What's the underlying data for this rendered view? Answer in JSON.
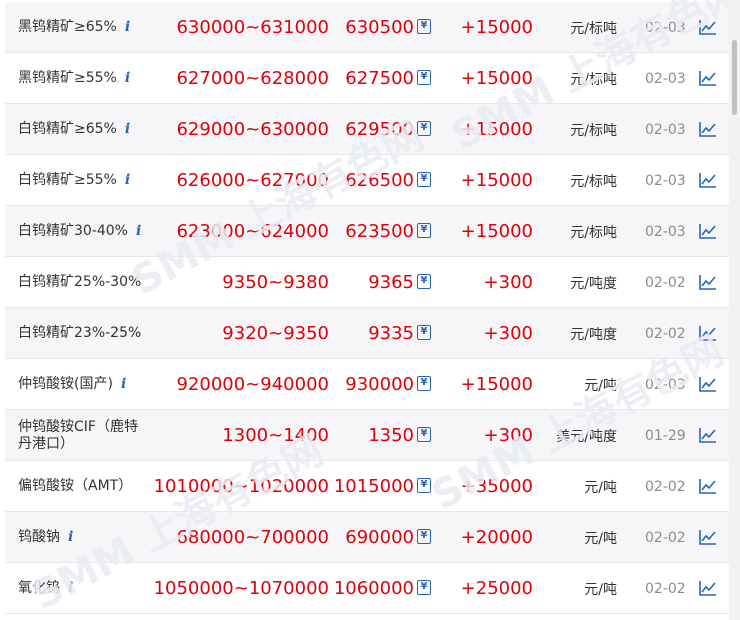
{
  "colors": {
    "price_red": "#e0000b",
    "info_blue": "#2a64b8",
    "text_dark": "#333333",
    "date_gray": "#8c8c8c",
    "row_alt": "#f6f6f8"
  },
  "icons": {
    "info": "i",
    "yuan": "¥",
    "trend": "line-chart-icon"
  },
  "rows": [
    {
      "name": "黑钨精矿≥65%",
      "has_info": true,
      "range": "630000~631000",
      "avg": "630500",
      "change": "+15000",
      "unit": "元/标吨",
      "date": "02-03"
    },
    {
      "name": "黑钨精矿≥55%",
      "has_info": true,
      "range": "627000~628000",
      "avg": "627500",
      "change": "+15000",
      "unit": "元/标吨",
      "date": "02-03"
    },
    {
      "name": "白钨精矿≥65%",
      "has_info": true,
      "range": "629000~630000",
      "avg": "629500",
      "change": "+15000",
      "unit": "元/标吨",
      "date": "02-03"
    },
    {
      "name": "白钨精矿≥55%",
      "has_info": true,
      "range": "626000~627000",
      "avg": "626500",
      "change": "+15000",
      "unit": "元/标吨",
      "date": "02-03"
    },
    {
      "name": "白钨精矿30-40%",
      "has_info": true,
      "range": "623000~624000",
      "avg": "623500",
      "change": "+15000",
      "unit": "元/标吨",
      "date": "02-03"
    },
    {
      "name": "白钨精矿25%-30%",
      "has_info": false,
      "range": "9350~9380",
      "avg": "9365",
      "change": "+300",
      "unit": "元/吨度",
      "date": "02-02"
    },
    {
      "name": "白钨精矿23%-25%",
      "has_info": false,
      "range": "9320~9350",
      "avg": "9335",
      "change": "+300",
      "unit": "元/吨度",
      "date": "02-02"
    },
    {
      "name": "仲钨酸铵(国产)",
      "has_info": true,
      "range": "920000~940000",
      "avg": "930000",
      "change": "+15000",
      "unit": "元/吨",
      "date": "02-03"
    },
    {
      "name": "仲钨酸铵CIF（鹿特丹港口）",
      "has_info": false,
      "range": "1300~1400",
      "avg": "1350",
      "change": "+300",
      "unit": "美元/吨度",
      "date": "01-29"
    },
    {
      "name": "偏钨酸铵（AMT）",
      "has_info": false,
      "range": "1010000~1020000",
      "avg": "1015000",
      "change": "+35000",
      "unit": "元/吨",
      "date": "02-02"
    },
    {
      "name": "钨酸钠",
      "has_info": true,
      "range": "680000~700000",
      "avg": "690000",
      "change": "+20000",
      "unit": "元/吨",
      "date": "02-02"
    },
    {
      "name": "氧化钨",
      "has_info": true,
      "range": "1050000~1070000",
      "avg": "1060000",
      "change": "+25000",
      "unit": "元/吨",
      "date": "02-02"
    }
  ]
}
